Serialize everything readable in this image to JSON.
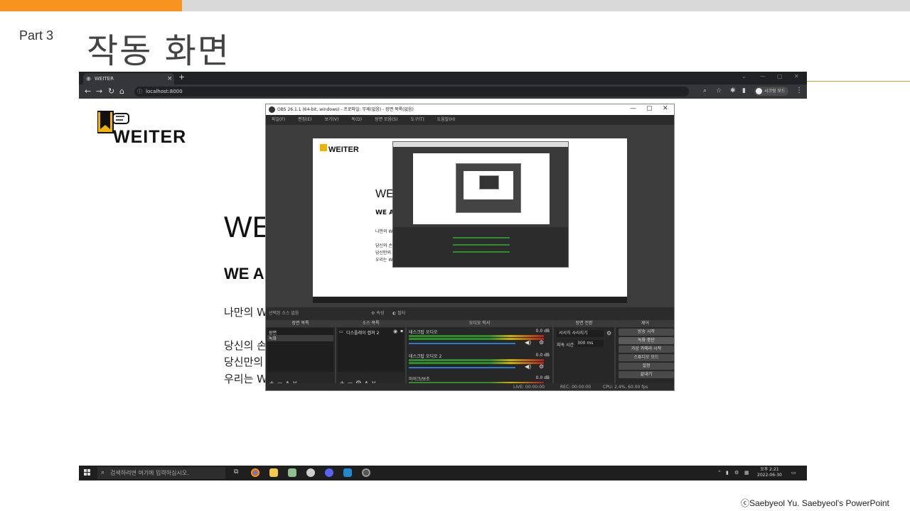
{
  "slide": {
    "part_label": "Part 3",
    "title": "작동 화면",
    "copyright": "ⓒSaebyeol Yu. Saebyeol's PowerPoint"
  },
  "browser": {
    "tab_title": "WEITER",
    "url": "localhost:8000",
    "profile_label": "시크릿 모드"
  },
  "page": {
    "logo_text": "WEITER",
    "hero_title": "WE",
    "hero_subtitle": "WE A",
    "line1": "나만의 W",
    "line2": "당신의 손",
    "line3": "당신만의",
    "line4": "우리는 W"
  },
  "obs": {
    "title": "OBS 26.1.1 (64-bit, windows) - 프로파일: 무제(없음) - 장면 목록(없음)",
    "menu": [
      "파일(F)",
      "편집(E)",
      "보기(V)",
      "독(D)",
      "장면 모음(S)",
      "도구(T)",
      "도움말(H)"
    ],
    "source_toolbar": "선택된 소스 없음",
    "source_toolbar_props": "속성",
    "source_toolbar_filters": "필터",
    "preview": {
      "logo": "WEITER",
      "hero": "WE",
      "sub": "WE A",
      "line1": "나만의 W",
      "line2": "당신의 손",
      "line3": "당신만의",
      "line4": "우리는 W"
    },
    "docks": {
      "scenes": {
        "header": "장면 목록",
        "items": [
          "장면",
          "녹화"
        ]
      },
      "sources": {
        "header": "소스 목록",
        "items": [
          "디스플레이 캡쳐 2"
        ]
      },
      "mixer": {
        "header": "오디오 믹서",
        "channels": [
          {
            "name": "데스크탑 오디오",
            "db": "0.0 dB"
          },
          {
            "name": "데스크탑 오디오 2",
            "db": "0.0 dB"
          },
          {
            "name": "마이크/보조",
            "db": "0.0 dB"
          }
        ]
      },
      "transitions": {
        "header": "장면 전환",
        "type": "서서히 사라지기",
        "duration_label": "지속 시간",
        "duration": "300 ms"
      },
      "controls": {
        "header": "제어",
        "buttons": [
          "방송 시작",
          "녹화 중단",
          "가상 카메라 시작",
          "스튜디오 모드",
          "설정",
          "끝내기"
        ]
      }
    },
    "status": {
      "live": "LIVE: 00:00:00",
      "rec": "REC: 00:00:00",
      "cpu": "CPU: 2.4%, 60.00 fps"
    }
  },
  "taskbar": {
    "search_placeholder": "검색하려면 여기에 입력하십시오.",
    "time": "오후 2:21",
    "date": "2022-06-30"
  },
  "colors": {
    "accent_orange": "#f7931e",
    "accent_gray": "#d9d9d9",
    "gold_line": "#c9a227",
    "logo_yellow": "#f2b200"
  }
}
